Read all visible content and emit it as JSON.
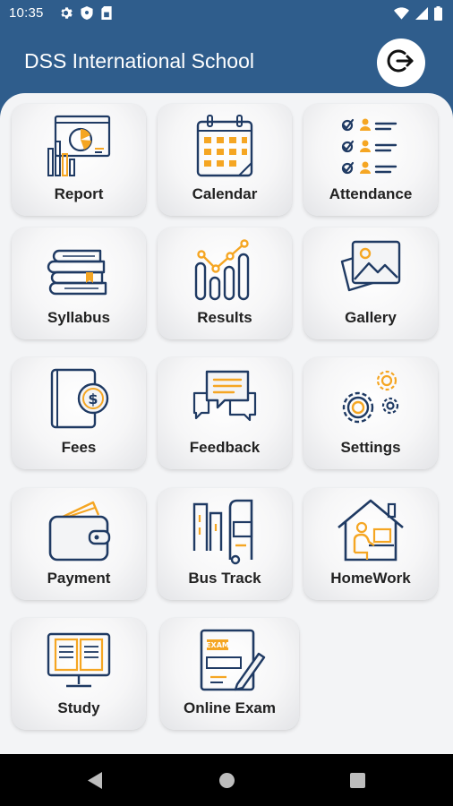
{
  "status_bar": {
    "time": "10:35"
  },
  "app_bar": {
    "title": "DSS International School"
  },
  "tiles": [
    {
      "label": "Report",
      "icon": "report-icon"
    },
    {
      "label": "Calendar",
      "icon": "calendar-icon"
    },
    {
      "label": "Attendance",
      "icon": "attendance-icon"
    },
    {
      "label": "Syllabus",
      "icon": "syllabus-icon"
    },
    {
      "label": "Results",
      "icon": "results-icon"
    },
    {
      "label": "Gallery",
      "icon": "gallery-icon"
    },
    {
      "label": "Fees",
      "icon": "fees-icon"
    },
    {
      "label": "Feedback",
      "icon": "feedback-icon"
    },
    {
      "label": "Settings",
      "icon": "settings-icon"
    },
    {
      "label": "Payment",
      "icon": "payment-icon"
    },
    {
      "label": "Bus Track",
      "icon": "bus-track-icon"
    },
    {
      "label": "HomeWork",
      "icon": "homework-icon"
    },
    {
      "label": "Study",
      "icon": "study-icon"
    },
    {
      "label": "Online Exam",
      "icon": "online-exam-icon"
    }
  ],
  "icon_labels": {
    "exam_sticker": "EXAM"
  },
  "colors": {
    "primary": "#2f5d8c",
    "icon_blue": "#1f3a63",
    "icon_accent": "#f5a623"
  }
}
